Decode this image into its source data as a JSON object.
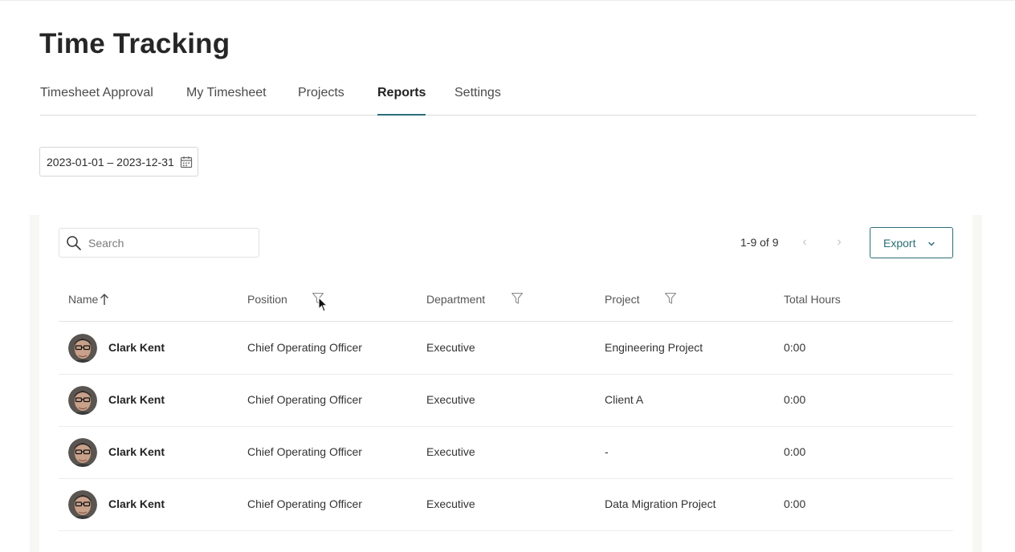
{
  "page": {
    "title": "Time Tracking"
  },
  "tabs": [
    {
      "label": "Timesheet Approval",
      "active": false
    },
    {
      "label": "My Timesheet",
      "active": false
    },
    {
      "label": "Projects",
      "active": false
    },
    {
      "label": "Reports",
      "active": true
    },
    {
      "label": "Settings",
      "active": false
    }
  ],
  "date_range": {
    "value": "2023-01-01 – 2023-12-31",
    "icon": "calendar-icon"
  },
  "search": {
    "placeholder": "Search",
    "value": "",
    "icon": "search-icon"
  },
  "pagination": {
    "text": "1-9 of 9",
    "prev_symbol": "‹",
    "next_symbol": "›"
  },
  "export": {
    "label": "Export",
    "icon": "chevron-down-icon"
  },
  "table": {
    "columns": {
      "name": "Name",
      "position": "Position",
      "department": "Department",
      "project": "Project",
      "total_hours": "Total Hours"
    },
    "sort": {
      "column": "name",
      "direction": "ascending"
    },
    "rows": [
      {
        "name": "Clark Kent",
        "position": "Chief Operating Officer",
        "department": "Executive",
        "project": "Engineering Project",
        "total_hours": "0:00"
      },
      {
        "name": "Clark Kent",
        "position": "Chief Operating Officer",
        "department": "Executive",
        "project": "Client A",
        "total_hours": "0:00"
      },
      {
        "name": "Clark Kent",
        "position": "Chief Operating Officer",
        "department": "Executive",
        "project": "-",
        "total_hours": "0:00"
      },
      {
        "name": "Clark Kent",
        "position": "Chief Operating Officer",
        "department": "Executive",
        "project": "Data Migration Project",
        "total_hours": "0:00"
      }
    ]
  },
  "colors": {
    "accent": "#2b6e78",
    "border": "#dcdcdc",
    "panel_bg": "#f7f7f5"
  }
}
